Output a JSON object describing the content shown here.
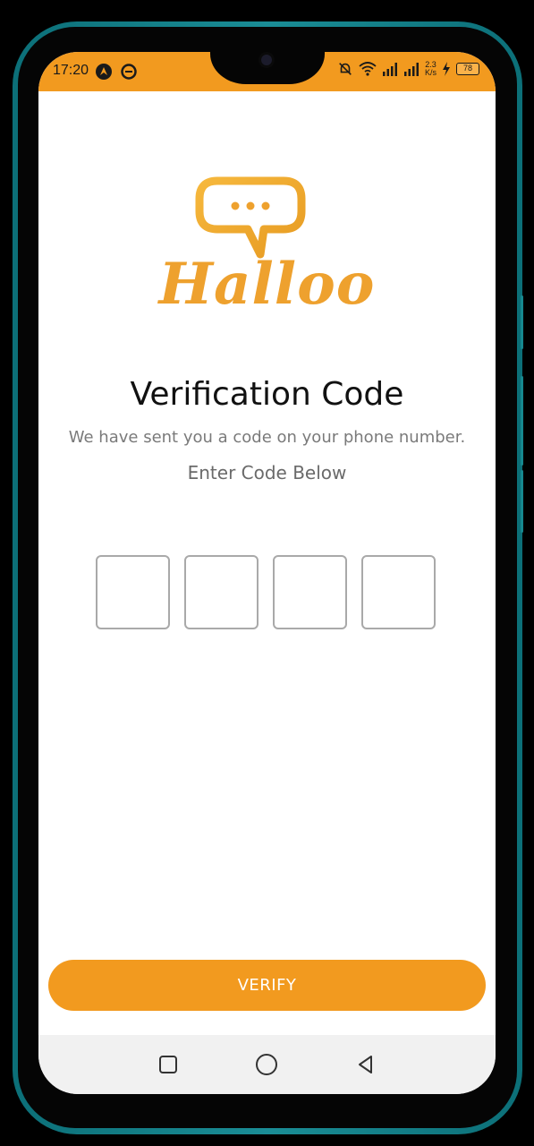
{
  "status_bar": {
    "time": "17:20",
    "net_speed_top": "2.3",
    "net_speed_unit": "K/s",
    "battery": "78"
  },
  "logo": {
    "text": "Halloo",
    "bubble_dots": "•••"
  },
  "verification": {
    "title": "Verification Code",
    "subtitle": "We have sent you a code on your phone number.",
    "enter_label": "Enter Code Below",
    "digits": [
      "",
      "",
      "",
      ""
    ]
  },
  "verify_button": {
    "label": "VERIFY"
  },
  "nav": {
    "recent_icon": "square-recents-icon",
    "home_icon": "circle-home-icon",
    "back_icon": "triangle-back-icon"
  },
  "colors": {
    "accent": "#f29a1f",
    "logo": "#eea12e",
    "frame": "#1a8d96"
  }
}
